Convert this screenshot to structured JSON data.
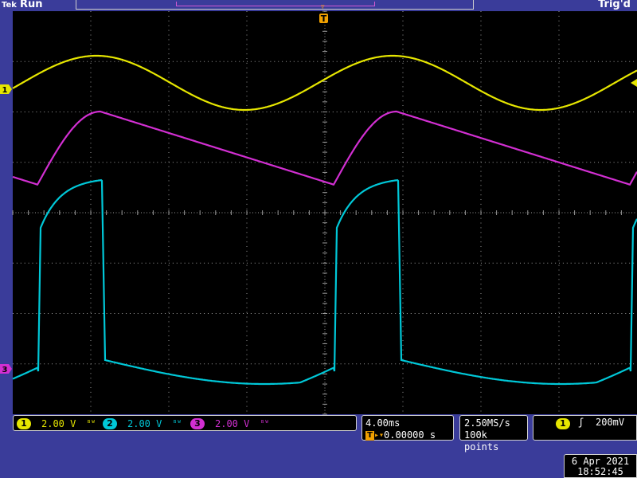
{
  "header": {
    "brand": "Tek",
    "run_state": "Run",
    "trigger_status": "Trig'd"
  },
  "markers": {
    "trigger_position": "T",
    "ch1": "1",
    "ch3": "3"
  },
  "channels": [
    {
      "number": "1",
      "scale": "2.00 V",
      "color": "#e6e600",
      "bandwidth_icon": "bandwidth-limit-icon"
    },
    {
      "number": "2",
      "scale": "2.00 V",
      "color": "#00c8d8",
      "bandwidth_icon": "bandwidth-limit-icon"
    },
    {
      "number": "3",
      "scale": "2.00 V",
      "color": "#d22fd2",
      "bandwidth_icon": "bandwidth-limit-icon"
    }
  ],
  "timebase": {
    "scale": "4.00ms",
    "trigger_delay": "0.00000 s"
  },
  "acquisition": {
    "sample_rate": "2.50MS/s",
    "record_length": "100k points"
  },
  "trigger": {
    "source": "1",
    "slope_icon": "rising-edge-icon",
    "level": "200mV"
  },
  "datetime": {
    "date": "6 Apr  2021",
    "time": "18:52:45"
  },
  "colors": {
    "background": "#3a3c9a",
    "graticule_bg": "#000000",
    "grid": "#9a9a9a",
    "trigger_marker": "#f0a000"
  }
}
